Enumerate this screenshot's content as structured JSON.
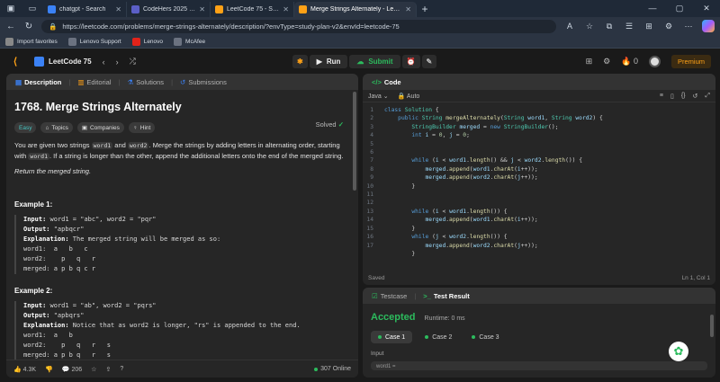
{
  "browser": {
    "tabs": [
      {
        "title": "chatgpt - Search",
        "icon_color": "#3b82f6",
        "active": false
      },
      {
        "title": "CodeHers 2025 - 2025 | 137206...",
        "icon_color": "#5b5fc7",
        "active": false
      },
      {
        "title": "LeetCode 75 - Study Plan - LeetC...",
        "icon_color": "#ffa116",
        "active": false
      },
      {
        "title": "Merge Strings Alternately - LeetC...",
        "icon_color": "#ffa116",
        "active": true
      }
    ],
    "url": "https://leetcode.com/problems/merge-strings-alternately/description/?envType=study-plan-v2&envId=leetcode-75",
    "bookmarks": [
      {
        "label": "Import favorites",
        "icon_color": "#888"
      },
      {
        "label": "Lenovo Support",
        "icon_color": "#6b7280"
      },
      {
        "label": "Lenovo",
        "icon_color": "#e2231a"
      },
      {
        "label": "McAfee",
        "icon_color": "#6b7280"
      }
    ]
  },
  "header": {
    "study_plan": "LeetCode 75",
    "run_label": "Run",
    "submit_label": "Submit",
    "notifications": "0",
    "premium_label": "Premium"
  },
  "left_panel": {
    "tabs": {
      "description": "Description",
      "editorial": "Editorial",
      "solutions": "Solutions",
      "submissions": "Submissions"
    },
    "title": "1768. Merge Strings Alternately",
    "solved_label": "Solved",
    "chips": {
      "difficulty": "Easy",
      "topics": "Topics",
      "companies": "Companies",
      "hint": "Hint"
    },
    "para1": {
      "a": "You are given two strings ",
      "code1": "word1",
      "b": " and ",
      "code2": "word2",
      "c": ". Merge the strings by adding letters in alternating order, starting with ",
      "code3": "word1",
      "d": ". If a string is longer than the other, append the additional letters onto the end of the merged string."
    },
    "return_text": "Return the merged string.",
    "examples": [
      {
        "heading": "Example 1:",
        "input": "word1 = \"abc\", word2 = \"pqr\"",
        "output": "\"apbqcr\"",
        "explanation": "The merged string will be merged as so:",
        "lines": [
          "word1:  a   b   c",
          "word2:    p   q   r",
          "merged: a p b q c r"
        ]
      },
      {
        "heading": "Example 2:",
        "input": "word1 = \"ab\", word2 = \"pqrs\"",
        "output": "\"apbqrs\"",
        "explanation": "Notice that as word2 is longer, \"rs\" is appended to the end.",
        "lines": [
          "word1:  a   b",
          "word2:    p   q   r   s",
          "merged: a p b q   r   s"
        ]
      }
    ],
    "footer": {
      "likes": "4.3K",
      "comments": "206",
      "online": "307 Online"
    }
  },
  "code_panel": {
    "tab_label": "Code",
    "language": "Java",
    "auto_label": "Auto",
    "status": "Saved",
    "cursor": "Ln 1, Col 1",
    "line_numbers": [
      "1",
      "2",
      "3",
      "4",
      "5",
      "6",
      "7",
      "8",
      "9",
      "10",
      "11",
      "12",
      "13",
      "14",
      "15",
      "16",
      "17"
    ]
  },
  "test_panel": {
    "testcase_tab": "Testcase",
    "result_tab": "Test Result",
    "verdict": "Accepted",
    "runtime": "Runtime: 0 ms",
    "cases": [
      "Case 1",
      "Case 2",
      "Case 3"
    ],
    "input_label": "Input",
    "input_value": "word1 ="
  },
  "colors": {
    "accent": "#ffa116",
    "accepted": "#2cbb5d",
    "easy": "#46c6c2"
  }
}
